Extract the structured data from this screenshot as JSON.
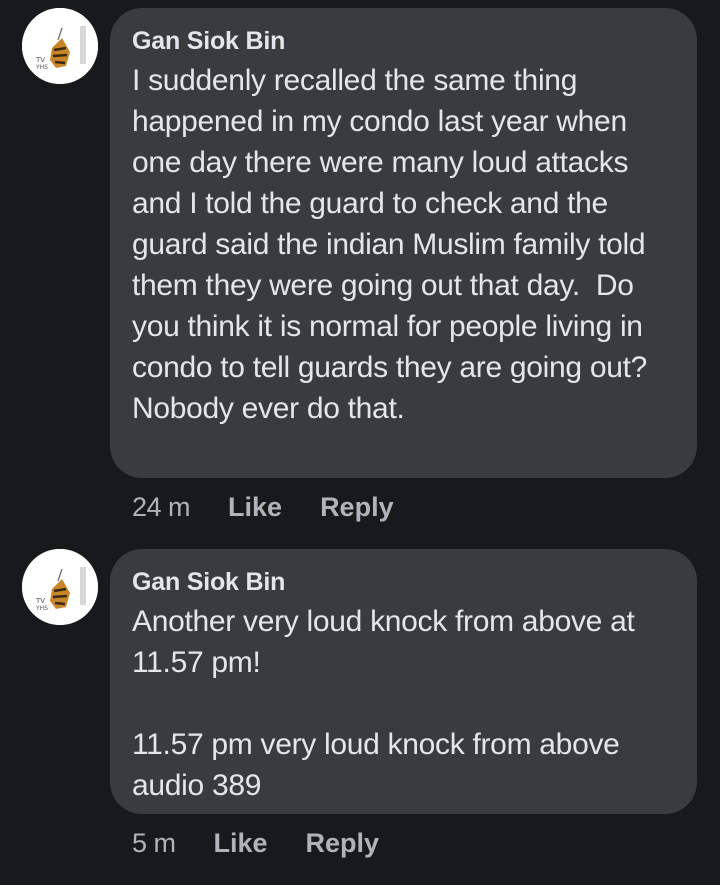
{
  "comments": [
    {
      "author": "Gan Siok Bin",
      "text": "I suddenly recalled the same thing happened in my condo last year when one day there were many loud attacks and I told the guard to check and the guard said the indian Muslim family told them they were going out that day.  Do you think it is normal for people living in condo to tell guards they are going out? Nobody ever do that.",
      "time": "24 m",
      "like_label": "Like",
      "reply_label": "Reply",
      "avatar_icon": "tiger-avatar-icon"
    },
    {
      "author": "Gan Siok Bin",
      "text": "Another very loud knock from above at 11.57 pm!\n\n11.57 pm very loud knock from above audio 389",
      "time": "5 m",
      "like_label": "Like",
      "reply_label": "Reply",
      "avatar_icon": "tiger-avatar-icon"
    }
  ],
  "colors": {
    "background": "#18191a",
    "bubble": "#3a3b3c",
    "text_primary": "#e4e6eb",
    "text_secondary": "#b0b3b8"
  }
}
